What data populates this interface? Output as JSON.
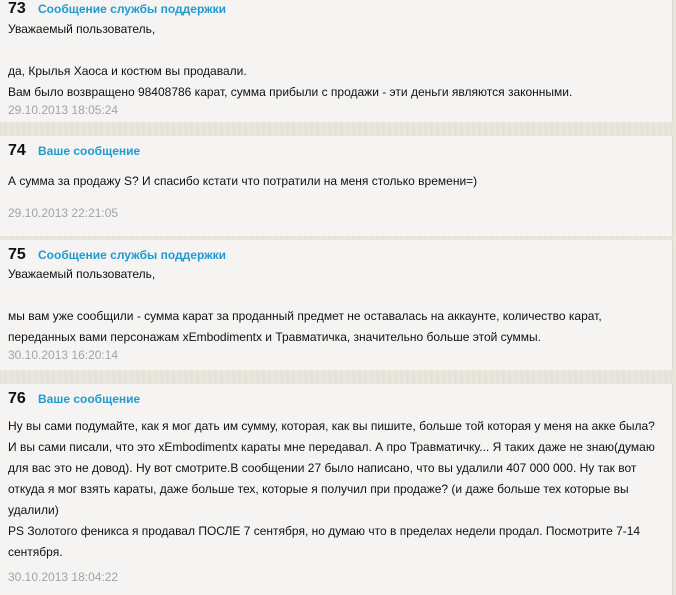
{
  "messages": [
    {
      "number": "73",
      "author": "Сообщение службы поддержки",
      "text": "Уважаемый пользователь,\n\nда, Крылья Хаоса и костюм вы продавали.\nВам было возвращено 98408786 карат, сумма прибыли с продажи - эти деньги являются законными.",
      "date": "29.10.2013 18:05:24"
    },
    {
      "number": "74",
      "author": "Ваше сообщение",
      "text": "А сумма за продажу S? И спасибо кстати что потратили на меня столько времени=)",
      "date": "29.10.2013 22:21:05"
    },
    {
      "number": "75",
      "author": "Сообщение службы поддержки",
      "text": "Уважаемый пользователь,\n\nмы вам уже сообщили - сумма карат за проданный предмет не оставалась на аккаунте, количество карат,\nпереданных вами персонажам xEmbodimentx и Травматичка, значительно больше этой суммы.",
      "date": "30.10.2013 16:20:14"
    },
    {
      "number": "76",
      "author": "Ваше сообщение",
      "text": "Ну вы сами подумайте, как я мог дать им сумму, которая, как вы пишите, больше той которая у меня на акке была?\nИ вы сами писали, что это xEmbodimentx караты мне передавал. А про Травматичку... Я таких даже не знаю(думаю\nдля вас это не довод). Ну вот смотрите.В сообщении 27 было написано, что вы удалили 407 000 000. Ну так вот\nоткуда я мог взять караты, даже больше тех, которые я получил при продаже? (и даже больше тех которые вы\nудалили)\nPS Золотого феникса я продавал ПОСЛЕ 7 сентября, но думаю что в пределах недели продал. Посмотрите 7-14\nсентября.",
      "date": "30.10.2013 18:04:22"
    }
  ]
}
